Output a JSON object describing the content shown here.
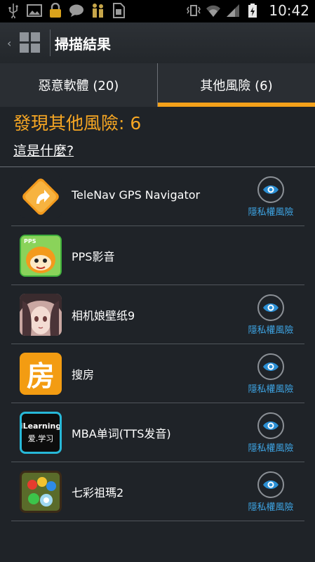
{
  "status_bar": {
    "time": "10:42",
    "left_icons": [
      "usb-icon",
      "image-icon",
      "lock-icon",
      "chat-icon",
      "figure-icon",
      "sim-icon"
    ],
    "right_icons": [
      "vibrate-icon",
      "wifi-icon",
      "signal-icon",
      "battery-charging-icon"
    ]
  },
  "action_bar": {
    "title": "掃描結果"
  },
  "tabs": [
    {
      "label": "惡意軟體 (20)",
      "selected": false
    },
    {
      "label": "其他風險 (6)",
      "selected": true
    }
  ],
  "heading": "發現其他風險: 6",
  "what_is_link": "這是什麼?",
  "apps": [
    {
      "name": "TeleNav GPS Navigator",
      "icon": "telenav-icon",
      "risk_label": "隱私權風險"
    },
    {
      "name": "PPS影音",
      "icon": "pps-icon",
      "risk_label": ""
    },
    {
      "name": "相机娘壁纸9",
      "icon": "anime-wallpaper-icon",
      "risk_label": "隱私權風險"
    },
    {
      "name": "搜房",
      "icon": "soufang-icon",
      "icon_text": "房",
      "risk_label": "隱私權風險"
    },
    {
      "name": "MBA单词(TTS发音)",
      "icon": "ilearning-icon",
      "icon_text_top": "iLearning",
      "icon_text_bottom": "爱.学习",
      "risk_label": "隱私權風險"
    },
    {
      "name": "七彩祖瑪2",
      "icon": "zuma-icon",
      "risk_label": "隱私權風險"
    }
  ],
  "colors": {
    "accent": "#f4a11a",
    "heading": "#f6a623",
    "risk_text": "#3ea6e6",
    "background": "#1f2328"
  }
}
